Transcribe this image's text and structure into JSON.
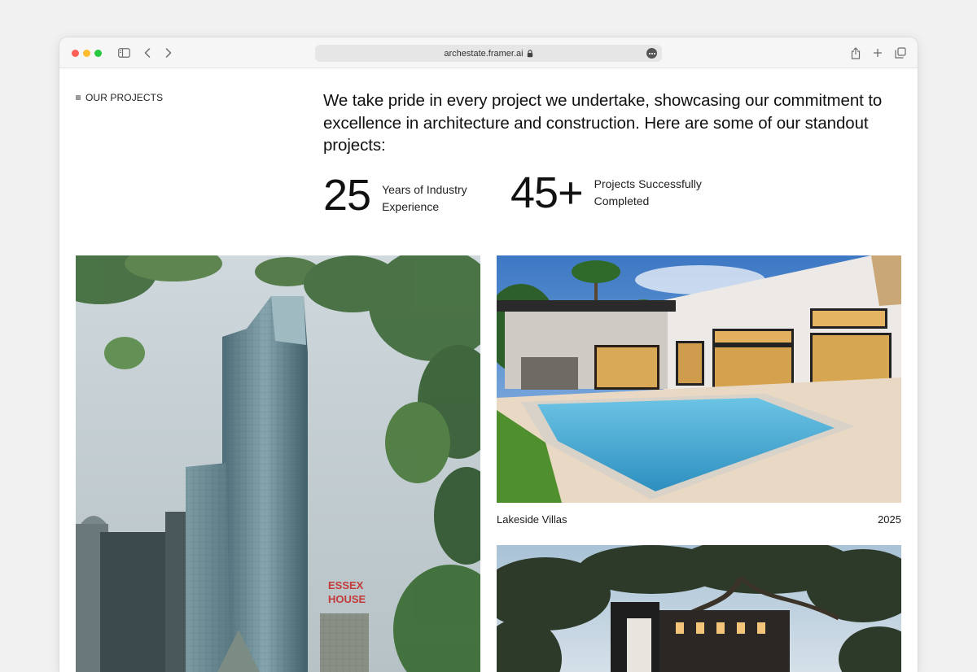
{
  "browser": {
    "url": "archestate.framer.ai",
    "icons": [
      "sidebar-icon",
      "back-icon",
      "forward-icon",
      "lock-icon",
      "more-icon",
      "share-icon",
      "new-tab-icon",
      "tabs-icon"
    ]
  },
  "section": {
    "label": "OUR PROJECTS"
  },
  "intro": {
    "text": "We take pride in every project we undertake, showcasing our commitment to excellence in architecture and construction. Here are some of our standout projects:"
  },
  "stats": [
    {
      "value": "25",
      "label": "Years of Industry Experience"
    },
    {
      "value": "45+",
      "label": "Projects Successfully Completed"
    }
  ],
  "projects": [
    {
      "name": "",
      "year": ""
    },
    {
      "name": "Lakeside Villas",
      "year": "2025"
    },
    {
      "name": "",
      "year": ""
    }
  ],
  "signage": {
    "line1": "ESSEX",
    "line2": "HOUSE"
  }
}
